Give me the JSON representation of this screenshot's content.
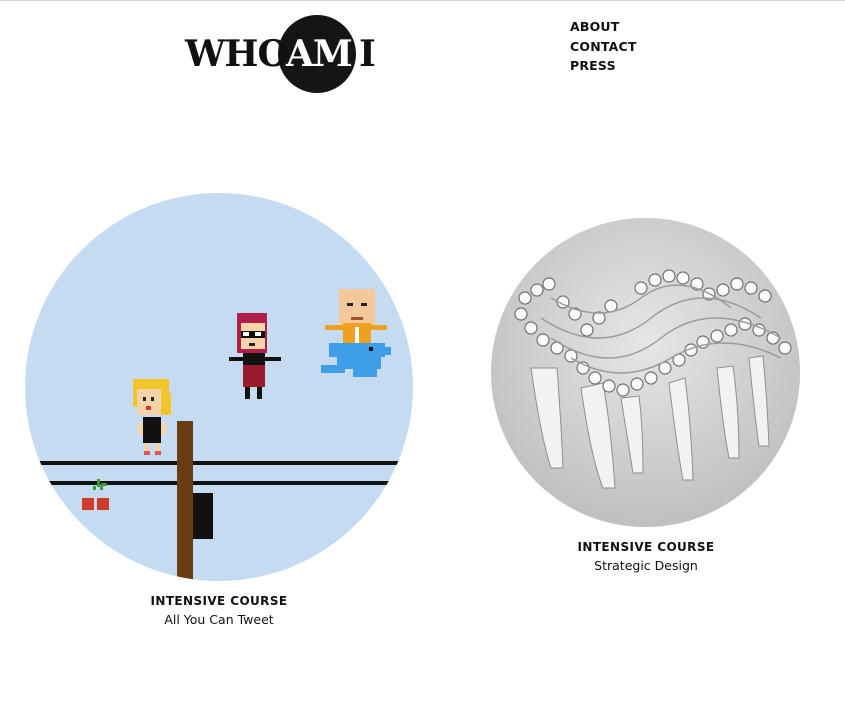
{
  "logo": {
    "word1": "WHO",
    "word2": "AM",
    "word3": "I"
  },
  "nav": {
    "items": [
      "ABOUT",
      "CONTACT",
      "PRESS"
    ]
  },
  "cards": [
    {
      "kicker": "INTENSIVE COURSE",
      "title": "All You Can Tweet"
    },
    {
      "kicker": "INTENSIVE COURSE",
      "title": "Strategic Design"
    }
  ],
  "colors": {
    "sky": "#c5dbf1",
    "pole": "#6b3c14",
    "bird": "#3f9ee8",
    "paper": "#d7d7d7"
  }
}
